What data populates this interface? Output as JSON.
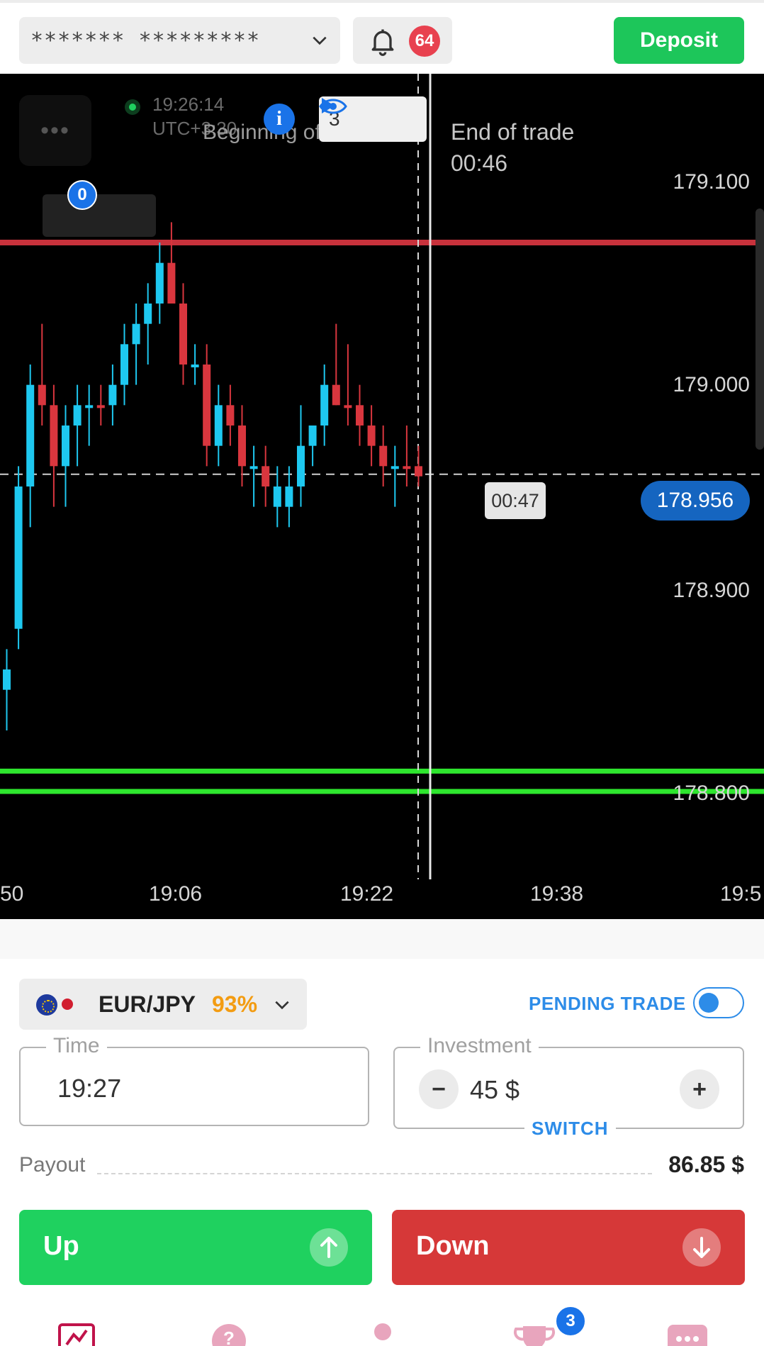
{
  "header": {
    "account_masked": "******* *********",
    "notification_count": "64",
    "deposit_label": "Deposit"
  },
  "chart": {
    "menu_dots": "•••",
    "open_trades_badge": "0",
    "clock_time": "19:26:14",
    "clock_tz": "UTC+3:30",
    "beginning_label": "Beginning of trade",
    "info_label": "i",
    "trade_count": "3",
    "end_of_trade_label": "End of trade",
    "end_of_trade_time": "00:46",
    "timer": "00:47",
    "current_price": "178.956",
    "price_ticks": [
      "179.100",
      "179.000",
      "178.900",
      "178.800"
    ],
    "time_ticks": [
      "50",
      "19:06",
      "19:22",
      "19:38",
      "19:5"
    ],
    "colors": {
      "up": "#1ec8f0",
      "down": "#d9363e",
      "red_line": "#c8323c",
      "green_line": "#2ee62e",
      "price_badge": "#1565c0"
    }
  },
  "chart_data": {
    "type": "candlestick",
    "ylim": [
      178.77,
      179.15
    ],
    "xlabel": "",
    "ylabel": "",
    "reference_lines": {
      "upper_red": 179.07,
      "lower_green_1": 178.81,
      "lower_green_2": 178.8,
      "current": 178.956
    },
    "candles": [
      {
        "o": 178.85,
        "h": 178.87,
        "l": 178.83,
        "c": 178.86,
        "dir": "up"
      },
      {
        "o": 178.88,
        "h": 178.96,
        "l": 178.87,
        "c": 178.95,
        "dir": "up"
      },
      {
        "o": 178.95,
        "h": 179.01,
        "l": 178.93,
        "c": 179.0,
        "dir": "up"
      },
      {
        "o": 179.0,
        "h": 179.03,
        "l": 178.98,
        "c": 178.99,
        "dir": "down"
      },
      {
        "o": 178.99,
        "h": 179.0,
        "l": 178.94,
        "c": 178.96,
        "dir": "down"
      },
      {
        "o": 178.96,
        "h": 178.99,
        "l": 178.94,
        "c": 178.98,
        "dir": "up"
      },
      {
        "o": 178.98,
        "h": 179.0,
        "l": 178.96,
        "c": 178.99,
        "dir": "up"
      },
      {
        "o": 178.99,
        "h": 179.0,
        "l": 178.97,
        "c": 178.99,
        "dir": "up"
      },
      {
        "o": 178.99,
        "h": 179.0,
        "l": 178.98,
        "c": 178.99,
        "dir": "down"
      },
      {
        "o": 178.99,
        "h": 179.01,
        "l": 178.98,
        "c": 179.0,
        "dir": "up"
      },
      {
        "o": 179.0,
        "h": 179.03,
        "l": 178.99,
        "c": 179.02,
        "dir": "up"
      },
      {
        "o": 179.02,
        "h": 179.04,
        "l": 179.0,
        "c": 179.03,
        "dir": "up"
      },
      {
        "o": 179.03,
        "h": 179.05,
        "l": 179.01,
        "c": 179.04,
        "dir": "up"
      },
      {
        "o": 179.04,
        "h": 179.07,
        "l": 179.03,
        "c": 179.06,
        "dir": "up"
      },
      {
        "o": 179.06,
        "h": 179.08,
        "l": 179.04,
        "c": 179.04,
        "dir": "down"
      },
      {
        "o": 179.04,
        "h": 179.05,
        "l": 179.0,
        "c": 179.01,
        "dir": "down"
      },
      {
        "o": 179.01,
        "h": 179.02,
        "l": 179.0,
        "c": 179.01,
        "dir": "up"
      },
      {
        "o": 179.01,
        "h": 179.02,
        "l": 178.96,
        "c": 178.97,
        "dir": "down"
      },
      {
        "o": 178.97,
        "h": 179.0,
        "l": 178.96,
        "c": 178.99,
        "dir": "up"
      },
      {
        "o": 178.99,
        "h": 179.0,
        "l": 178.97,
        "c": 178.98,
        "dir": "down"
      },
      {
        "o": 178.98,
        "h": 178.99,
        "l": 178.95,
        "c": 178.96,
        "dir": "down"
      },
      {
        "o": 178.96,
        "h": 178.97,
        "l": 178.94,
        "c": 178.96,
        "dir": "up"
      },
      {
        "o": 178.96,
        "h": 178.97,
        "l": 178.94,
        "c": 178.95,
        "dir": "down"
      },
      {
        "o": 178.95,
        "h": 178.96,
        "l": 178.93,
        "c": 178.94,
        "dir": "up"
      },
      {
        "o": 178.94,
        "h": 178.96,
        "l": 178.93,
        "c": 178.95,
        "dir": "up"
      },
      {
        "o": 178.95,
        "h": 178.99,
        "l": 178.94,
        "c": 178.97,
        "dir": "up"
      },
      {
        "o": 178.97,
        "h": 178.98,
        "l": 178.96,
        "c": 178.98,
        "dir": "up"
      },
      {
        "o": 178.98,
        "h": 179.01,
        "l": 178.97,
        "c": 179.0,
        "dir": "up"
      },
      {
        "o": 179.0,
        "h": 179.03,
        "l": 178.99,
        "c": 178.99,
        "dir": "down"
      },
      {
        "o": 178.99,
        "h": 179.02,
        "l": 178.98,
        "c": 178.99,
        "dir": "down"
      },
      {
        "o": 178.99,
        "h": 179.0,
        "l": 178.97,
        "c": 178.98,
        "dir": "down"
      },
      {
        "o": 178.98,
        "h": 178.99,
        "l": 178.96,
        "c": 178.97,
        "dir": "down"
      },
      {
        "o": 178.97,
        "h": 178.98,
        "l": 178.95,
        "c": 178.96,
        "dir": "down"
      },
      {
        "o": 178.96,
        "h": 178.97,
        "l": 178.94,
        "c": 178.96,
        "dir": "up"
      },
      {
        "o": 178.96,
        "h": 178.98,
        "l": 178.95,
        "c": 178.96,
        "dir": "down"
      },
      {
        "o": 178.96,
        "h": 178.97,
        "l": 178.95,
        "c": 178.955,
        "dir": "down"
      }
    ]
  },
  "trade_panel": {
    "asset_name": "EUR/JPY",
    "asset_payout_pct": "93%",
    "pending_trade_label": "PENDING TRADE",
    "time_legend": "Time",
    "time_value": "19:27",
    "investment_legend": "Investment",
    "investment_value": "45 $",
    "minus_label": "−",
    "plus_label": "+",
    "switch_label": "SWITCH",
    "payout_label": "Payout",
    "payout_value": "86.85 $",
    "up_label": "Up",
    "down_label": "Down"
  },
  "bottom_nav": {
    "tournaments_badge": "3",
    "icons": [
      "trading-chart-icon",
      "help-icon",
      "profile-icon",
      "trophy-icon",
      "more-icon"
    ]
  }
}
